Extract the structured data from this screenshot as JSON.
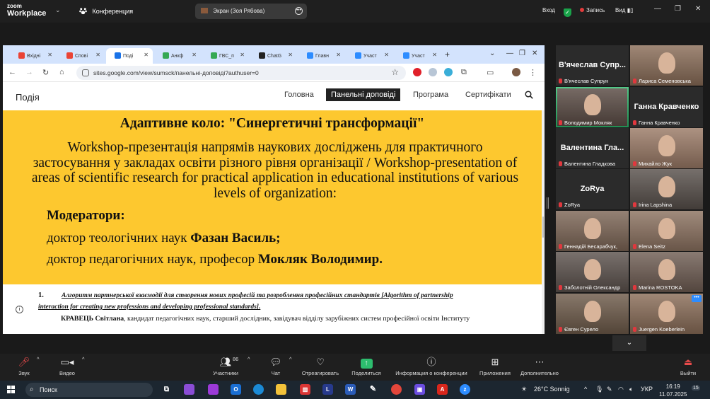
{
  "zoom": {
    "logo_line1": "zoom",
    "logo_line2": "Workplace",
    "conference_label": "Конференция",
    "share_tab_label": "Экран (Зоя Рябова)",
    "login_label": "Вход",
    "record_label": "Запись",
    "view_label": "Вид"
  },
  "browser": {
    "tabs": [
      {
        "label": "Вхідні",
        "icon": "gmail-icon",
        "color": "#ea4335"
      },
      {
        "label": "Спові",
        "icon": "gmail-icon",
        "color": "#ea4335"
      },
      {
        "label": "Поді",
        "icon": "google-sites-icon",
        "color": "#1a73e8"
      },
      {
        "label": "Анкф",
        "icon": "google-drive-icon",
        "color": "#34a853"
      },
      {
        "label": "ГВС_п",
        "icon": "google-drive-icon",
        "color": "#34a853"
      },
      {
        "label": "ChatG",
        "icon": "chatgpt-icon",
        "color": "#222222"
      },
      {
        "label": "Главн",
        "icon": "zoom-icon",
        "color": "#2d8cff"
      },
      {
        "label": "Участ",
        "icon": "zoom-icon",
        "color": "#2d8cff"
      },
      {
        "label": "Участ",
        "icon": "zoom-icon",
        "color": "#2d8cff"
      }
    ],
    "url": "sites.google.com/view/sumsck/панельні-доповіді?authuser=0"
  },
  "site": {
    "title": "Подія",
    "nav": [
      "Головна",
      "Панельні доповіді",
      "Програма",
      "Сертифікати"
    ],
    "active_nav": "Панельні доповіді",
    "heading": "Адаптивне коло: \"Синергетичні трансформації\"",
    "description": "Workshop-презентація напрямів наукових досліджень для практичного застосування у закладах освіти різного рівня організації / Workshop-presentation of areas of scientific research for practical application in educational institutions of various levels of organization:",
    "moderators_label": "Модератори:",
    "moderator1_prefix": "доктор теологічних наук ",
    "moderator1_name": "Фазан Василь;",
    "moderator2_prefix": "доктор педагогічних наук, професор ",
    "moderator2_name": "Мокляк Володимир.",
    "item_number": "1.",
    "item_title_line1": "Алгоритм партнерської взаємодії для створення нових професій та розроблення професійних стандартів [Algorithm of partnership",
    "item_title_line2": "interaction for creating new professions and developing professional standards].",
    "item_author": "КРАВЕЦЬ Світлана",
    "item_author_rest": ", кандидат педагогічних наук, старший дослідник, завідувач відділу зарубіжних систем професійної освіти Інституту"
  },
  "participants": [
    {
      "name": "В'ячеслав Супрун",
      "big": "В'ячеслав Супр...",
      "video": false
    },
    {
      "name": "Лариса Семеновська",
      "video": true
    },
    {
      "name": "Володимир Мокляк",
      "video": true,
      "active": true
    },
    {
      "name": "Ганна Кравченко",
      "big": "Ганна Кравченко",
      "video": false
    },
    {
      "name": "Валентина Гладкова",
      "big": "Валентина Гла...",
      "video": false
    },
    {
      "name": "Михайло Жук",
      "video": true
    },
    {
      "name": "ZoRya",
      "big": "ZoRya",
      "video": false
    },
    {
      "name": "Irina Lapshina",
      "video": true
    },
    {
      "name": "Геннадій Бесарабчук,",
      "video": true
    },
    {
      "name": "Elena Seitz",
      "video": true
    },
    {
      "name": "Заболотній Олександр",
      "video": true
    },
    {
      "name": "Marina ROSTOKA",
      "video": true
    },
    {
      "name": "Євген Сурело",
      "video": true
    },
    {
      "name": "Juergen Koeberlein",
      "video": true
    }
  ],
  "toolbar": {
    "audio": "Звук",
    "video": "Видео",
    "participants": "Участники",
    "participants_count": "86",
    "chat": "Чат",
    "react": "Отреагировать",
    "share": "Поделиться",
    "info": "Информация о конференции",
    "apps": "Приложения",
    "more": "Дополнительно",
    "leave": "Выйти"
  },
  "taskbar": {
    "search": "Поиск",
    "weather": "26°C Sonnig",
    "lang": "УКР",
    "time": "16:19",
    "date": "11.07.2025",
    "notifications": "15"
  }
}
